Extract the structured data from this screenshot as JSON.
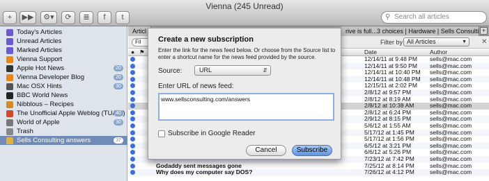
{
  "window": {
    "title": "Vienna (245 Unread)"
  },
  "toolbar": {
    "buttons": [
      {
        "name": "add-subscription-button",
        "label": "+"
      },
      {
        "name": "skip-unread-button",
        "label": "▶▶"
      },
      {
        "name": "action-menu-button",
        "label": "⚙▾"
      },
      {
        "name": "refresh-button",
        "label": "⟳"
      },
      {
        "name": "styles-button",
        "label": "≣"
      },
      {
        "name": "facebook-button",
        "label": "f"
      },
      {
        "name": "twitter-button",
        "label": "t"
      }
    ],
    "search_placeholder": "Search all articles",
    "search_icon": "search-icon"
  },
  "sidebar": {
    "items": [
      {
        "label": "Today's Articles",
        "icon_color": "#6a5acd",
        "count": ""
      },
      {
        "label": "Unread Articles",
        "icon_color": "#6a5acd",
        "count": ""
      },
      {
        "label": "Marked Articles",
        "icon_color": "#6a5acd",
        "count": ""
      },
      {
        "label": "Vienna Support",
        "icon_color": "#e8861a",
        "count": ""
      },
      {
        "label": "Apple Hot News",
        "icon_color": "#333333",
        "count": "20"
      },
      {
        "label": "Vienna Developer Blog",
        "icon_color": "#e8861a",
        "count": "20"
      },
      {
        "label": "Mac OSX Hints",
        "icon_color": "#555555",
        "count": "30"
      },
      {
        "label": "BBC World News",
        "icon_color": "#222222",
        "count": ""
      },
      {
        "label": "Nibblous – Recipes",
        "icon_color": "#d48a2a",
        "count": ""
      },
      {
        "label": "The Unofficial Apple Weblog (TUAW)",
        "icon_color": "#d04a2a",
        "count": "40"
      },
      {
        "label": "World of Apple",
        "icon_color": "#777777",
        "count": "30"
      },
      {
        "label": "Trash",
        "icon_color": "#888888",
        "count": ""
      },
      {
        "label": "Sells Consulting answers",
        "icon_color": "#e0b040",
        "count": "37"
      }
    ],
    "selected_index": 12
  },
  "tabs": {
    "left_tab": "Articl",
    "right_tab": "rive is full...3 choices | Hardware | Sells Consulting"
  },
  "filter": {
    "label": "Filter by",
    "value": "All Articles"
  },
  "columns": {
    "date": "Date",
    "author": "Author",
    "subject_partial": "Fil"
  },
  "articles": [
    {
      "subject": "",
      "date": "12/14/11 at 9:48 PM",
      "author": "sells@mac.com"
    },
    {
      "subject": "",
      "date": "12/14/11 at 9:50 PM",
      "author": "sells@mac.com"
    },
    {
      "subject": "",
      "date": "12/14/11 at 10:40 PM",
      "author": "sells@mac.com"
    },
    {
      "subject": "",
      "date": "12/14/11 at 10:48 PM",
      "author": "sells@mac.com"
    },
    {
      "subject": "",
      "date": "12/15/11 at 2:02 PM",
      "author": "sells@mac.com"
    },
    {
      "subject": "",
      "date": "2/8/12 at 9:57 PM",
      "author": "sells@mac.com"
    },
    {
      "subject": "",
      "date": "2/8/12 at 8:19 AM",
      "author": "sells@mac.com"
    },
    {
      "subject": "",
      "date": "2/8/12 at 10:38 AM",
      "author": "sells@mac.com"
    },
    {
      "subject": "",
      "date": "2/8/12 at 6:24 PM",
      "author": "sells@mac.com"
    },
    {
      "subject": "",
      "date": "2/9/12 at 8:15 PM",
      "author": "sells@mac.com"
    },
    {
      "subject": "",
      "date": "5/6/12 at 1:55 AM",
      "author": "sells@mac.com"
    },
    {
      "subject": "",
      "date": "5/17/12 at 1:45 PM",
      "author": "sells@mac.com"
    },
    {
      "subject": "",
      "date": "5/17/12 at 1:56 PM",
      "author": "sells@mac.com"
    },
    {
      "subject": "",
      "date": "6/5/12 at 3:21 PM",
      "author": "sells@mac.com"
    },
    {
      "subject": "",
      "date": "6/6/12 at 5:26 PM",
      "author": "sells@mac.com"
    },
    {
      "subject": "",
      "date": "7/23/12 at 7:42 PM",
      "author": "sells@mac.com"
    },
    {
      "subject": "Godaddy sent messages gone",
      "date": "7/25/12 at 8:14 PM",
      "author": "sells@mac.com"
    },
    {
      "subject": "Why does my computer say DOS?",
      "date": "7/26/12 at 4:12 PM",
      "author": "sells@mac.com"
    }
  ],
  "selected_article_index": 7,
  "dialog": {
    "title": "Create a new subscription",
    "description": "Enter the link for the news feed below. Or choose from the Source list to enter a shortcut name for the news feed provided by the source.",
    "source_label": "Source:",
    "source_value": "URL",
    "url_label": "Enter URL of news feed:",
    "url_value": "www.sellsconsulting.com/answers",
    "google_reader_label": "Subscribe in Google Reader",
    "cancel_label": "Cancel",
    "subscribe_label": "Subscribe"
  }
}
